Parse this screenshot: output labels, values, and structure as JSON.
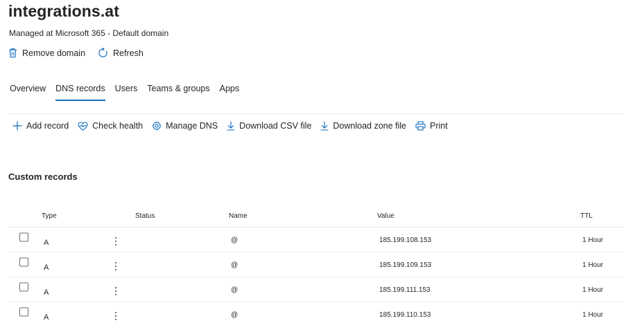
{
  "domain": {
    "title": "integrations.at",
    "subtitle": "Managed at Microsoft 365 - Default domain"
  },
  "actions": [
    {
      "label": "Remove domain",
      "icon": "trash-icon"
    },
    {
      "label": "Refresh",
      "icon": "refresh-icon"
    }
  ],
  "tabs": [
    {
      "label": "Overview",
      "active": false
    },
    {
      "label": "DNS records",
      "active": true
    },
    {
      "label": "Users",
      "active": false
    },
    {
      "label": "Teams & groups",
      "active": false
    },
    {
      "label": "Apps",
      "active": false
    }
  ],
  "toolbar": [
    {
      "label": "Add record",
      "icon": "plus-icon"
    },
    {
      "label": "Check health",
      "icon": "heart-pulse-icon"
    },
    {
      "label": "Manage DNS",
      "icon": "gear-icon"
    },
    {
      "label": "Download CSV file",
      "icon": "download-icon"
    },
    {
      "label": "Download zone file",
      "icon": "download-icon"
    },
    {
      "label": "Print",
      "icon": "print-icon"
    }
  ],
  "section_title": "Custom records",
  "table": {
    "columns": [
      "Type",
      "Status",
      "Name",
      "Value",
      "TTL"
    ],
    "rows": [
      {
        "type": "A",
        "status": "",
        "name": "@",
        "value": "185.199.108.153",
        "ttl": "1 Hour"
      },
      {
        "type": "A",
        "status": "",
        "name": "@",
        "value": "185.199.109.153",
        "ttl": "1 Hour"
      },
      {
        "type": "A",
        "status": "",
        "name": "@",
        "value": "185.199.111.153",
        "ttl": "1 Hour"
      },
      {
        "type": "A",
        "status": "",
        "name": "@",
        "value": "185.199.110.153",
        "ttl": "1 Hour"
      }
    ]
  },
  "colors": {
    "accent": "#0f6cbd",
    "text": "#242424"
  }
}
